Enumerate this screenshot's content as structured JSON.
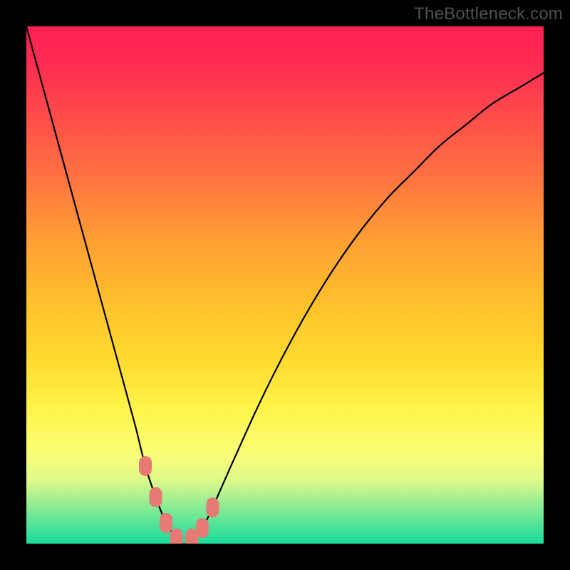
{
  "watermark": "TheBottleneck.com",
  "chart_data": {
    "type": "line",
    "title": "",
    "xlabel": "",
    "ylabel": "",
    "xlim": [
      0,
      100
    ],
    "ylim": [
      0,
      100
    ],
    "grid": false,
    "legend": false,
    "series": [
      {
        "name": "bottleneck-curve",
        "color": "#000000",
        "x": [
          0,
          3,
          6,
          9,
          12,
          15,
          18,
          21,
          23,
          25,
          27,
          29,
          30,
          31,
          32,
          34,
          36,
          40,
          45,
          50,
          55,
          60,
          65,
          70,
          75,
          80,
          85,
          90,
          95,
          100
        ],
        "y": [
          100,
          89,
          78,
          67,
          56,
          45,
          34,
          23,
          15,
          9,
          4,
          1,
          0,
          0,
          1,
          3,
          7,
          16,
          27,
          37,
          46,
          54,
          61,
          67,
          72,
          77,
          81,
          85,
          88,
          91
        ]
      }
    ],
    "markers": [
      {
        "name": "marker-1",
        "x": 23,
        "y": 15,
        "color": "#e77a74"
      },
      {
        "name": "marker-2",
        "x": 25,
        "y": 9,
        "color": "#e77a74"
      },
      {
        "name": "marker-3",
        "x": 27,
        "y": 4,
        "color": "#e77a74"
      },
      {
        "name": "marker-4",
        "x": 29,
        "y": 1,
        "color": "#e77a74"
      },
      {
        "name": "marker-5",
        "x": 32,
        "y": 1,
        "color": "#e77a74"
      },
      {
        "name": "marker-6",
        "x": 34,
        "y": 3,
        "color": "#e77a74"
      },
      {
        "name": "marker-7",
        "x": 36,
        "y": 7,
        "color": "#e77a74"
      }
    ],
    "background_gradient": {
      "type": "vertical",
      "stops": [
        {
          "pos": 0.0,
          "color": "#ff1f54"
        },
        {
          "pos": 0.3,
          "color": "#ff763f"
        },
        {
          "pos": 0.54,
          "color": "#ffc22c"
        },
        {
          "pos": 0.8,
          "color": "#fdfd6a"
        },
        {
          "pos": 0.94,
          "color": "#78e996"
        },
        {
          "pos": 1.0,
          "color": "#19dd9a"
        }
      ]
    }
  }
}
